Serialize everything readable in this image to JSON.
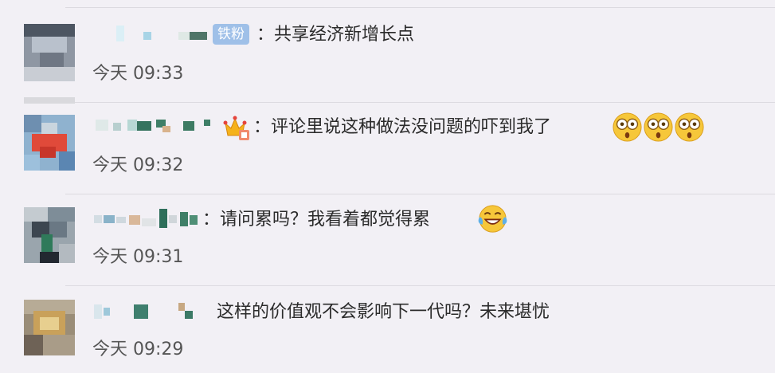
{
  "comments": [
    {
      "badge": "铁粉",
      "text": "：共享经济新增长点",
      "time": "今天 09:33"
    },
    {
      "badge_icon": "crown-vip-icon",
      "text": "：评论里说这种做法没问题的吓到我了",
      "emojis": [
        "shocked-face-icon",
        "shocked-face-icon",
        "shocked-face-icon"
      ],
      "time": "今天 09:32"
    },
    {
      "text": "：请问累吗？我看着都觉得累",
      "emojis": [
        "laughing-crying-face-icon"
      ],
      "time": "今天 09:31"
    },
    {
      "text": "这样的价值观不会影响下一代吗？未来堪忧",
      "time": "今天 09:29"
    }
  ],
  "colors": {
    "background": "#f2f0f5",
    "separator": "#dcdae0",
    "badge": "#9fc0e8",
    "emoji_face": "#f6c73a"
  }
}
